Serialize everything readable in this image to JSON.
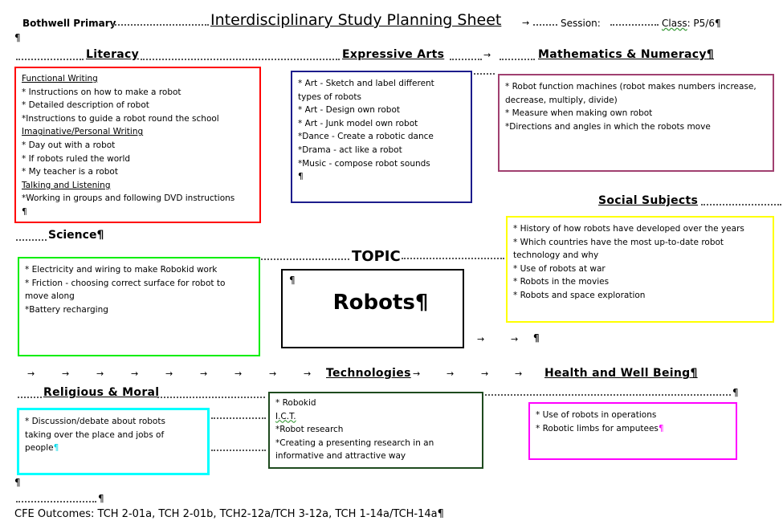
{
  "header": {
    "school": "Bothwell Primary",
    "title": "Interdisciplinary Study Planning Sheet",
    "session_label": "Session:",
    "class_label": "Class",
    "class_value": ": P5/6"
  },
  "topic": {
    "label": "TOPIC",
    "name": "Robots"
  },
  "sections": {
    "literacy": {
      "title": "Literacy",
      "color": "#ff0000",
      "lines": [
        {
          "text": "Functional Writing",
          "underline": true
        },
        {
          "text": "* Instructions on how to make a robot"
        },
        {
          "text": "* Detailed description of robot"
        },
        {
          "text": "*Instructions to guide a robot round the school"
        },
        {
          "text": "Imaginative/Personal Writing",
          "underline": true
        },
        {
          "text": "* Day out with a robot"
        },
        {
          "text": "* If robots ruled the world"
        },
        {
          "text": "* My teacher is a robot"
        },
        {
          "text": "Talking and Listening",
          "underline": true
        },
        {
          "text": "*Working in groups and following DVD instructions"
        }
      ]
    },
    "expressive_arts": {
      "title": "Expressive Arts",
      "color": "#1c1c8c",
      "lines": [
        {
          "text": "* Art - Sketch and label different"
        },
        {
          "text": "types of robots"
        },
        {
          "text": "* Art - Design own robot"
        },
        {
          "text": "* Art - Junk model own robot"
        },
        {
          "text": "*Dance - Create a robotic dance"
        },
        {
          "text": "*Drama - act like a robot"
        },
        {
          "text": "*Music - compose robot sounds"
        }
      ]
    },
    "mathematics": {
      "title": "Mathematics & Numeracy",
      "color": "#a04070",
      "lines": [
        {
          "text": "* Robot function machines (robot makes numbers increase,"
        },
        {
          "text": "decrease, multiply, divide)"
        },
        {
          "text": "* Measure when making own robot"
        },
        {
          "text": "*Directions and angles in which the robots move"
        }
      ]
    },
    "social_subjects": {
      "title": "Social Subjects",
      "color": "#ffff00",
      "lines": [
        {
          "text": "* History of how robots have developed over the years"
        },
        {
          "text": "* Which countries have the most up-to-date robot"
        },
        {
          "text": "technology and why"
        },
        {
          "text": "* Use of robots at war"
        },
        {
          "text": "* Robots in the movies"
        },
        {
          "text": "* Robots and space exploration"
        }
      ]
    },
    "science": {
      "title": "Science",
      "color": "#00ee00",
      "lines": [
        {
          "text": "* Electricity and wiring to make Robokid work"
        },
        {
          "text": "* Friction - choosing correct surface for robot to"
        },
        {
          "text": "move along"
        },
        {
          "text": "*Battery recharging"
        }
      ]
    },
    "technologies": {
      "title": "Technologies",
      "color": "#1e4a1e",
      "lines": [
        {
          "text": "* Robokid"
        },
        {
          "text": "I.C.T.",
          "underline": true
        },
        {
          "text": "*Robot research"
        },
        {
          "text": "*Creating a presenting research in an"
        },
        {
          "text": "informative and attractive way"
        }
      ]
    },
    "religious_moral": {
      "title": "Religious & Moral",
      "color": "#00ffff",
      "lines": [
        {
          "text": "* Discussion/debate about robots"
        },
        {
          "text": "taking over the place and jobs of"
        },
        {
          "text": "people"
        }
      ]
    },
    "health": {
      "title": "Health and Well Being",
      "color": "#ff00ff",
      "lines": [
        {
          "text": "* Use of robots in operations"
        },
        {
          "text": "* Robotic limbs for amputees"
        }
      ]
    }
  },
  "footer": {
    "outcomes": "CFE Outcomes:  TCH 2-01a, TCH 2-01b, TCH2-12a/TCH 3-12a, TCH 1-14a/TCH-14a"
  },
  "glyphs": {
    "pilcrow": "¶",
    "arrow": "→"
  }
}
